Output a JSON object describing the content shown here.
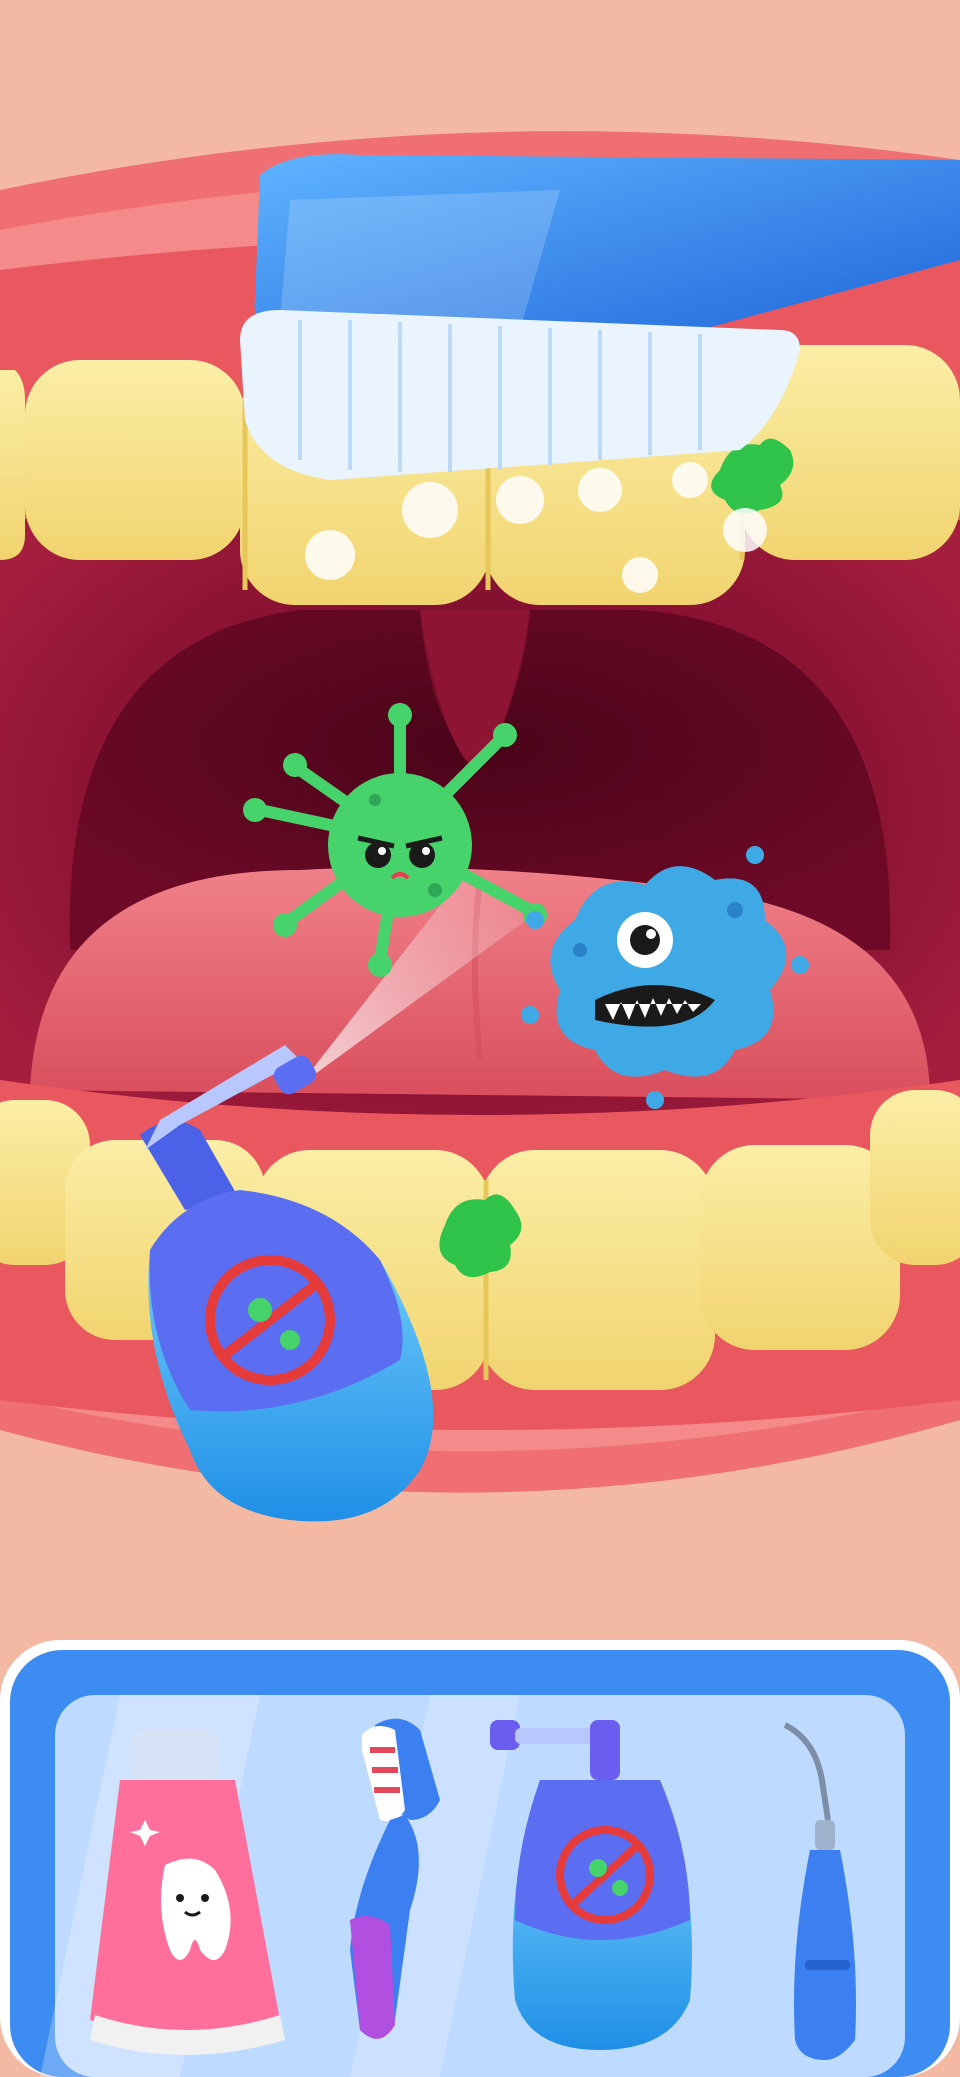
{
  "screen": "tooth-brushing-game",
  "colors": {
    "background": "#f3b9a2",
    "lip": "#ef6f72",
    "mouth_inner": "#8b0f2f",
    "throat": "#5b0520",
    "tongue": "#e7606b",
    "tooth": "#f7e38a",
    "germ_green": "#46d36b",
    "germ_blue": "#3fa9e6",
    "plaque": "#2fc34a",
    "tray_blue": "#3d8cf2",
    "tray_inner": "#bfdaff"
  },
  "scene": {
    "brush_icon": "toothbrush-icon",
    "spray_icon": "antigerm-spray-icon",
    "germs": [
      {
        "kind": "spiky-virus",
        "color": "green"
      },
      {
        "kind": "one-eyed-bacteria",
        "color": "blue"
      }
    ],
    "plaque_spots": 2
  },
  "toolbar": {
    "tools": [
      {
        "name": "toothpaste",
        "icon": "toothpaste-icon"
      },
      {
        "name": "toothbrush",
        "icon": "toothbrush-icon"
      },
      {
        "name": "spray",
        "icon": "antigerm-spray-icon"
      },
      {
        "name": "dental-scaler",
        "icon": "dental-pick-icon"
      }
    ]
  }
}
